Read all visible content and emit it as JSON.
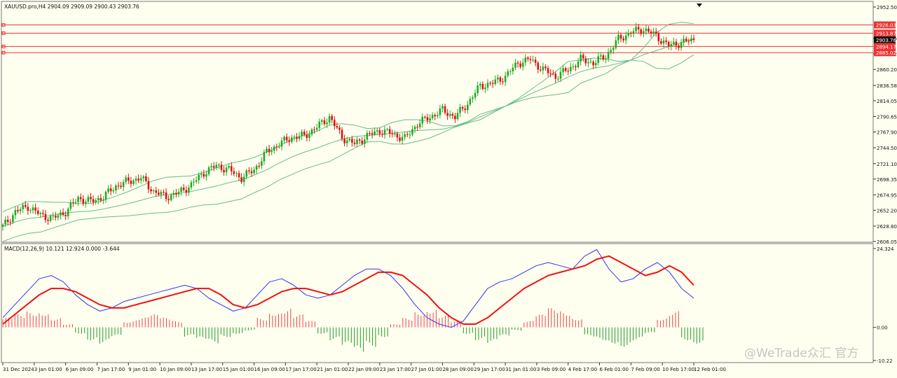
{
  "header": {
    "symbol_line": "XAUUSD.pro,H4  2904.09 2909.09 2900.43 2903.76"
  },
  "macd_header": "MACD(12,26,9) 10.121 12.924 0.000 -3.644",
  "watermark": "@WeTrade众汇 官方",
  "colors": {
    "background": "#fffff0",
    "bull": "#22aa22",
    "bear": "#dd1111",
    "bands": "#66bb88",
    "level_lines": "#ee3333",
    "macd_line": "#3333ee",
    "signal_line": "#ee1111",
    "hist_up": "#ee4444",
    "hist_down": "#229922"
  },
  "chart_data": [
    {
      "type": "candlestick",
      "timeframe": "H4",
      "price_axis": {
        "labels": [
          "2952.50",
          "2906.26",
          "2883.22",
          "2860.20",
          "2836.58",
          "2814.05",
          "2790.65",
          "2767.90",
          "2744.50",
          "2721.10",
          "2698.35",
          "2674.95",
          "2652.20",
          "2628.80",
          "2606.05"
        ],
        "ylim": [
          2606.05,
          2952.5
        ]
      },
      "time_axis": {
        "labels": [
          "31 Dec 2024",
          "3 Jan 01:00",
          "6 Jan 09:00",
          "7 Jan 17:00",
          "9 Jan 01:00",
          "10 Jan 09:00",
          "13 Jan 17:00",
          "15 Jan 01:00",
          "16 Jan 09:00",
          "17 Jan 17:00",
          "21 Jan 01:00",
          "22 Jan 09:00",
          "23 Jan 17:00",
          "27 Jan 01:00",
          "28 Jan 09:00",
          "29 Jan 17:00",
          "31 Jan 01:00",
          "3 Feb 09:00",
          "4 Feb 17:00",
          "6 Feb 01:00",
          "7 Feb 09:00",
          "10 Feb 17:00",
          "12 Feb 01:00"
        ]
      },
      "levels": [
        {
          "price": 2926.03,
          "label": "2926.03",
          "label_bg": "#ee3333"
        },
        {
          "price": 2913.87,
          "label": "2913.87",
          "label_bg": "#ee3333"
        },
        {
          "price": 2903.76,
          "label": "2903.76",
          "label_bg": "#111111",
          "current": true
        },
        {
          "price": 2894.17,
          "label": "2894.17",
          "label_bg": "#ee3333"
        },
        {
          "price": 2885.02,
          "label": "2885.02",
          "label_bg": "#ee3333"
        }
      ],
      "bollinger": {
        "upper": [
          2650,
          2658,
          2665,
          2665,
          2664,
          2664,
          2662,
          2662,
          2667,
          2673,
          2680,
          2688,
          2696,
          2701,
          2702,
          2703,
          2708,
          2715,
          2721,
          2725,
          2730,
          2738,
          2747,
          2757,
          2763,
          2769,
          2778,
          2780,
          2778,
          2773,
          2774,
          2782,
          2786,
          2786,
          2783,
          2777,
          2777,
          2783,
          2794,
          2800,
          2806,
          2817,
          2830,
          2843,
          2857,
          2872,
          2874,
          2877,
          2876,
          2872,
          2874,
          2892,
          2914,
          2927,
          2930,
          2928
        ],
        "middle": [
          2628,
          2635,
          2640,
          2642,
          2645,
          2648,
          2650,
          2651,
          2654,
          2658,
          2662,
          2667,
          2672,
          2675,
          2677,
          2680,
          2684,
          2688,
          2693,
          2697,
          2704,
          2712,
          2722,
          2731,
          2738,
          2744,
          2751,
          2757,
          2761,
          2763,
          2764,
          2766,
          2768,
          2770,
          2771,
          2772,
          2776,
          2782,
          2790,
          2798,
          2806,
          2815,
          2824,
          2832,
          2840,
          2849,
          2857,
          2862,
          2865,
          2869,
          2874,
          2882,
          2888,
          2894,
          2900,
          2905
        ],
        "lower": [
          2606,
          2613,
          2618,
          2620,
          2626,
          2632,
          2638,
          2640,
          2642,
          2643,
          2644,
          2646,
          2648,
          2649,
          2652,
          2657,
          2660,
          2661,
          2665,
          2669,
          2678,
          2686,
          2697,
          2705,
          2713,
          2719,
          2724,
          2734,
          2744,
          2753,
          2754,
          2750,
          2750,
          2754,
          2759,
          2767,
          2775,
          2781,
          2786,
          2796,
          2806,
          2813,
          2818,
          2821,
          2823,
          2826,
          2840,
          2847,
          2854,
          2866,
          2874,
          2872,
          2862,
          2861,
          2870,
          2882
        ]
      },
      "closes": [
        2628,
        2650,
        2658,
        2645,
        2640,
        2650,
        2670,
        2665,
        2672,
        2688,
        2695,
        2700,
        2680,
        2672,
        2678,
        2690,
        2708,
        2718,
        2712,
        2700,
        2712,
        2738,
        2750,
        2760,
        2762,
        2775,
        2790,
        2760,
        2750,
        2762,
        2770,
        2765,
        2758,
        2780,
        2790,
        2800,
        2790,
        2810,
        2836,
        2840,
        2850,
        2870,
        2875,
        2860,
        2850,
        2860,
        2875,
        2870,
        2880,
        2905,
        2915,
        2920,
        2910,
        2895,
        2900,
        2904
      ]
    },
    {
      "type": "line",
      "name": "MACD(12,26,9)",
      "values_shown": {
        "macd": 10.121,
        "signal": 12.924,
        "extra_1": 0.0,
        "extra_2": -3.644
      },
      "axis_labels": [
        "24.324",
        "0.00",
        "-10.22"
      ],
      "ylim": [
        -10.22,
        24.324
      ],
      "macd_line": [
        3,
        7,
        11,
        15,
        16,
        14,
        10,
        7,
        5,
        6,
        8,
        9,
        10,
        11,
        12,
        13,
        12,
        9,
        7,
        5,
        6,
        10,
        14,
        15,
        13,
        10,
        9,
        10,
        13,
        16,
        18,
        18,
        16,
        12,
        7,
        3,
        1,
        0,
        2,
        7,
        12,
        14,
        15,
        17,
        19,
        20,
        19,
        18,
        22,
        24,
        18,
        14,
        15,
        18,
        20,
        17,
        12,
        9
      ],
      "signal_line": [
        1,
        4,
        7,
        10,
        12,
        12,
        11,
        9,
        7,
        6,
        6,
        7,
        8,
        9,
        10,
        11,
        12,
        12,
        10,
        7,
        6,
        7,
        9,
        11,
        12,
        12,
        11,
        10,
        11,
        13,
        15,
        17,
        17,
        16,
        13,
        10,
        6,
        3,
        1,
        1,
        3,
        6,
        9,
        12,
        14,
        16,
        17,
        18,
        19,
        21,
        22,
        20,
        18,
        16,
        17,
        19,
        17,
        13
      ],
      "histogram": [
        3,
        4,
        5,
        5,
        3,
        1,
        -2,
        -4,
        -5,
        -3,
        2,
        3,
        4,
        3,
        2,
        -3,
        -4,
        -5,
        -3,
        -2,
        -1,
        3,
        5,
        6,
        4,
        2,
        -2,
        -4,
        -6,
        -8,
        -6,
        -3,
        1,
        3,
        5,
        6,
        4,
        2,
        -2,
        -4,
        -5,
        -3,
        -1,
        2,
        4,
        6,
        5,
        3,
        -3,
        -4,
        -5,
        -6,
        -4,
        -2,
        3,
        5,
        -4,
        -5
      ]
    }
  ]
}
